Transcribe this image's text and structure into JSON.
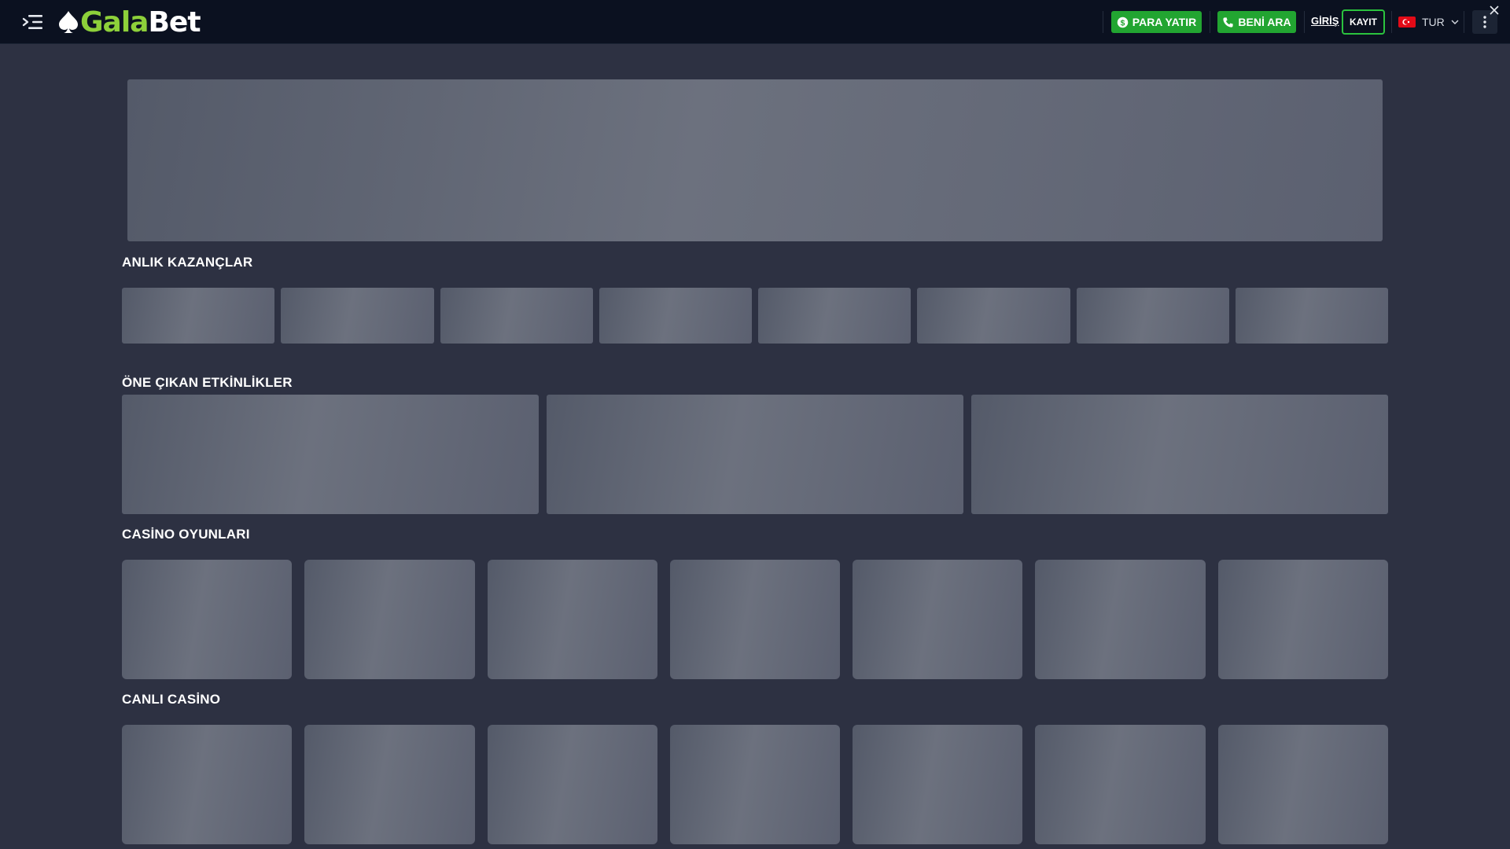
{
  "header": {
    "logo": {
      "part1": "Gala",
      "part2": "Bet",
      "icon": "spade-icon"
    },
    "menu_icon": "menu-icon",
    "deposit_label": "PARA YATIR",
    "callback_label": "BENİ ARA",
    "login_label": "GİRİŞ",
    "register_label": "KAYIT",
    "language": {
      "code": "TUR",
      "flag": "turkey-flag"
    },
    "colors": {
      "accent_green": "#22a531",
      "logo_green": "#8dd03a",
      "register_border": "#2bc33e",
      "background": "#0b1120"
    }
  },
  "sections": {
    "instant_wins": {
      "title": "ANLIK KAZANÇLAR"
    },
    "featured_events": {
      "title": "ÖNE ÇIKAN ETKİNLİKLER"
    },
    "casino_games": {
      "title": "CASİNO OYUNLARI"
    },
    "live_casino": {
      "title": "CANLI CASİNO"
    }
  },
  "page": {
    "background": "#2d3142",
    "loading_placeholder_color": "#60656f"
  }
}
